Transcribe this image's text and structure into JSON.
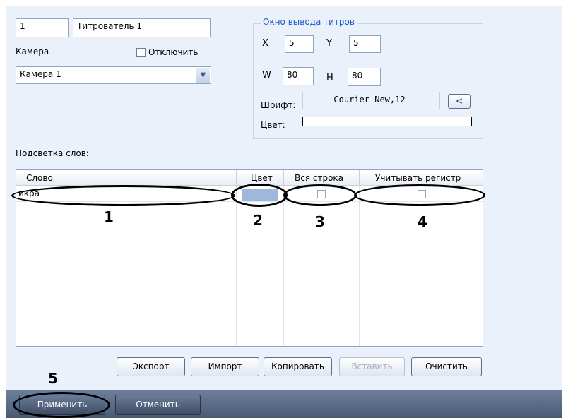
{
  "top": {
    "id_value": "1",
    "name_value": "Титрователь 1",
    "camera_label": "Камера",
    "disable_label": "Отключить",
    "camera_select": "Камера 1"
  },
  "output": {
    "title": "Окно вывода титров",
    "x_label": "X",
    "x_value": "5",
    "y_label": "Y",
    "y_value": "5",
    "w_label": "W",
    "w_value": "80",
    "h_label": "H",
    "h_value": "80",
    "font_label": "Шрифт:",
    "font_value": "Courier New,12",
    "font_button": "<",
    "color_label": "Цвет:"
  },
  "highlight": {
    "label": "Подсветка слов:",
    "columns": [
      "Слово",
      "Цвет",
      "Вся строка",
      "Учитывать регистр"
    ],
    "rows": [
      {
        "word": "икра",
        "color": "#9db8db",
        "whole_line": false,
        "case_sensitive": false
      }
    ]
  },
  "buttons": {
    "export": "Экспорт",
    "import": "Импорт",
    "copy": "Копировать",
    "paste": "Вставить",
    "clear": "Очистить"
  },
  "footer": {
    "apply": "Применить",
    "cancel": "Отменить"
  },
  "callouts": [
    "1",
    "2",
    "3",
    "4",
    "5"
  ]
}
